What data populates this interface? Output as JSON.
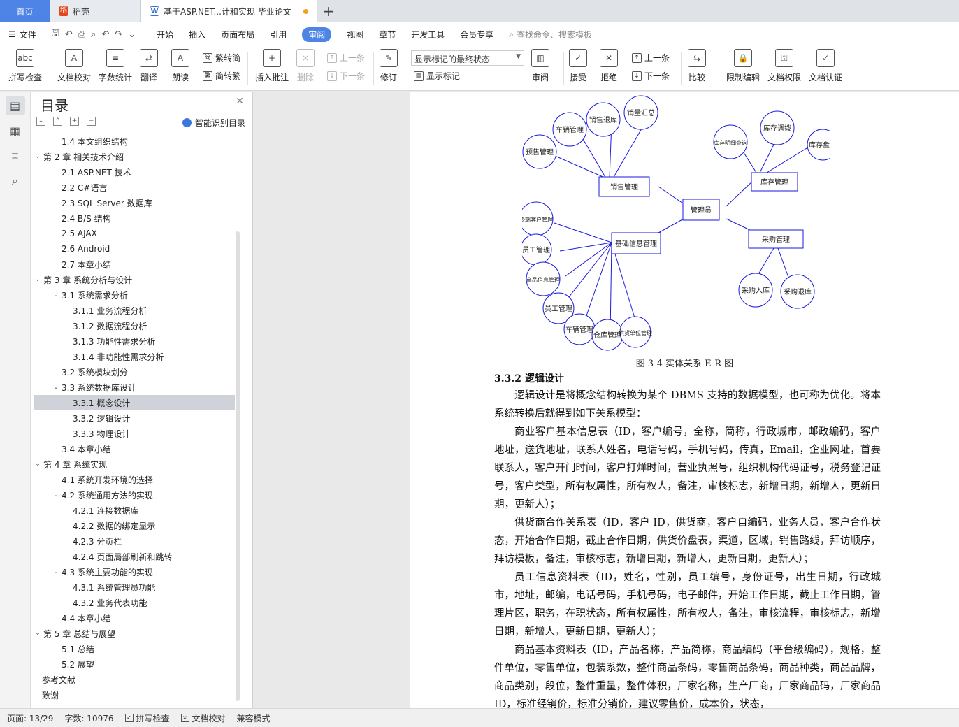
{
  "tabs": {
    "home": "首页",
    "daoke": "稻壳",
    "doc": "基于ASP.NET...计和实现 毕业论文"
  },
  "menu": {
    "file": "文件",
    "items": [
      "开始",
      "插入",
      "页面布局",
      "引用",
      "审阅",
      "视图",
      "章节",
      "开发工具",
      "会员专享"
    ],
    "active": "审阅",
    "search": "查找命令、搜索模板"
  },
  "ribbon": {
    "spell": "拼写检查",
    "proof": "文档校对",
    "count": "字数统计",
    "translate": "翻译",
    "read": "朗读",
    "trad": "繁转简",
    "simp": "简转繁",
    "comment": "插入批注",
    "delete": "删除",
    "prev_c": "上一条",
    "next_c": "下一条",
    "track": "修订",
    "combo": "显示标记的最终状态",
    "show_mark": "显示标记",
    "review": "审阅",
    "accept": "接受",
    "reject": "拒绝",
    "prev": "上一条",
    "next": "下一条",
    "compare": "比较",
    "restrict": "限制编辑",
    "perm": "文档权限",
    "cert": "文档认证"
  },
  "toc": {
    "title": "目录",
    "smart": "智能识别目录",
    "items": [
      {
        "text": "1.4  本文组织结构",
        "level": 2
      },
      {
        "text": "第 2 章  相关技术介绍",
        "level": 1,
        "caret": true
      },
      {
        "text": "2.1 ASP.NET 技术",
        "level": 2
      },
      {
        "text": "2.2 C#语言",
        "level": 2
      },
      {
        "text": "2.3 SQL Server 数据库",
        "level": 2
      },
      {
        "text": "2.4 B/S 结构",
        "level": 2
      },
      {
        "text": "2.5 AJAX",
        "level": 2
      },
      {
        "text": "2.6 Android",
        "level": 2
      },
      {
        "text": "2.7 本章小结",
        "level": 2
      },
      {
        "text": "第 3 章  系统分析与设计",
        "level": 1,
        "caret": true
      },
      {
        "text": "3.1  系统需求分析",
        "level": 2,
        "caret": true
      },
      {
        "text": "3.1.1  业务流程分析",
        "level": 3
      },
      {
        "text": "3.1.2  数据流程分析",
        "level": 3
      },
      {
        "text": "3.1.3  功能性需求分析",
        "level": 3
      },
      {
        "text": "3.1.4  非功能性需求分析",
        "level": 3
      },
      {
        "text": "3.2  系统模块划分",
        "level": 2
      },
      {
        "text": "3.3  系统数据库设计",
        "level": 2,
        "caret": true
      },
      {
        "text": "3.3.1  概念设计",
        "level": 3,
        "selected": true
      },
      {
        "text": "3.3.2  逻辑设计",
        "level": 3
      },
      {
        "text": "3.3.3  物理设计",
        "level": 3
      },
      {
        "text": "3.4  本章小结",
        "level": 2
      },
      {
        "text": "第 4 章  系统实现",
        "level": 1,
        "caret": true
      },
      {
        "text": "4.1  系统开发环境的选择",
        "level": 2
      },
      {
        "text": "4.2  系统通用方法的实现",
        "level": 2,
        "caret": true
      },
      {
        "text": "4.2.1  连接数据库",
        "level": 3
      },
      {
        "text": "4.2.2  数据的绑定显示",
        "level": 3
      },
      {
        "text": "4.2.3  分页栏",
        "level": 3
      },
      {
        "text": "4.2.4  页面局部刷新和跳转",
        "level": 3
      },
      {
        "text": "4.3  系统主要功能的实现",
        "level": 2,
        "caret": true
      },
      {
        "text": "4.3.1  系统管理员功能",
        "level": 3
      },
      {
        "text": "4.3.2  业务代表功能",
        "level": 3
      },
      {
        "text": "4.4  本章小结",
        "level": 2
      },
      {
        "text": "第 5 章  总结与展望",
        "level": 1,
        "caret": true
      },
      {
        "text": "5.1  总结",
        "level": 2
      },
      {
        "text": "5.2  展望",
        "level": 2
      },
      {
        "text": "参考文献",
        "level": 1
      },
      {
        "text": "致谢",
        "level": 1
      }
    ]
  },
  "diagram": {
    "center": "管理员",
    "sales": "销售管理",
    "inventory": "库存管理",
    "base": "基础信息管理",
    "purchase": "采购管理",
    "sales_e": [
      "预售管理",
      "车销管理",
      "销售退库",
      "销量汇总"
    ],
    "inv_e": [
      "库存明细查询",
      "库存调拨",
      "库存盘点"
    ],
    "pur_e": [
      "采购入库",
      "采购退库"
    ],
    "base_e": [
      "终端客户管理",
      "员工管理",
      "商品信息管理",
      "员工管理",
      "车辆管理",
      "仓库管理",
      "供货单位管理"
    ]
  },
  "doc": {
    "caption": "图 3-4 实体关系 E-R 图",
    "heading": "3.3.2  逻辑设计",
    "paragraphs": [
      "逻辑设计是将概念结构转换为某个 DBMS 支持的数据模型，也可称为优化。将本系统转换后就得到如下关系模型：",
      "商业客户基本信息表（ID，客户编号，全称，简称，行政城市，邮政编码，客户地址，送货地址，联系人姓名，电话号码，手机号码，传真，Email，企业网址，首要联系人，客户开门时间，客户打烊时间，营业执照号，组织机构代码证号，税务登记证号，客户类型，所有权属性，所有权人，备注，审核标志，新增日期，新增人，更新日期，更新人）；",
      "供货商合作关系表（ID，客户 ID，供货商，客户自编码，业务人员，客户合作状态，开始合作日期，截止合作日期，供货价盘表，渠道，区域，销售路线，拜访顺序，拜访模板，备注，审核标志，新增日期，新增人，更新日期，更新人）；",
      "员工信息资料表（ID，姓名，性别，员工编号，身份证号，出生日期，行政城市，地址，邮编，电话号码，手机号码，电子邮件，开始工作日期，截止工作日期，管理片区，职务，在职状态，所有权属性，所有权人，备注，审核流程，审核标志，新增日期，新增人，更新日期，更新人）；",
      "商品基本资料表（ID，产品名称，产品简称，商品编码（平台级编码），规格，整件单位，零售单位，包装系数，整件商品条码，零售商品条码，商品种类，商品品牌，商品类别，段位，整件重量，整件体积，厂家名称，生产厂商，厂家商品码，厂家商品 ID，标准经销价，标准分销价，建议零售价，成本价，状态，"
    ]
  },
  "status": {
    "page": "页面: 13/29",
    "words": "字数: 10976",
    "spell": "拼写检查",
    "proof": "文档校对",
    "compat": "兼容模式"
  }
}
